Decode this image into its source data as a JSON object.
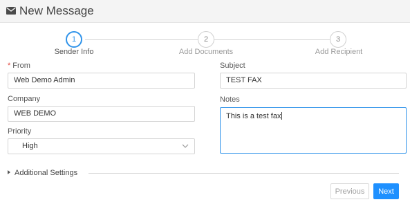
{
  "header": {
    "title": "New Message",
    "icon": "envelope-icon"
  },
  "steps": [
    {
      "number": "1",
      "label": "Sender Info",
      "active": true
    },
    {
      "number": "2",
      "label": "Add Documents",
      "active": false
    },
    {
      "number": "3",
      "label": "Add Recipient",
      "active": false
    }
  ],
  "form": {
    "from": {
      "label": "From",
      "required_mark": "*",
      "value": "Web Demo Admin"
    },
    "company": {
      "label": "Company",
      "value": "WEB DEMO"
    },
    "priority": {
      "label": "Priority",
      "value": "High"
    },
    "subject": {
      "label": "Subject",
      "value": "TEST FAX"
    },
    "notes": {
      "label": "Notes",
      "value": "This is a test fax"
    }
  },
  "additional_settings": {
    "label": "Additional Settings"
  },
  "buttons": {
    "previous": "Previous",
    "next": "Next"
  },
  "colors": {
    "accent": "#1e90ff",
    "required": "#e0443c"
  }
}
